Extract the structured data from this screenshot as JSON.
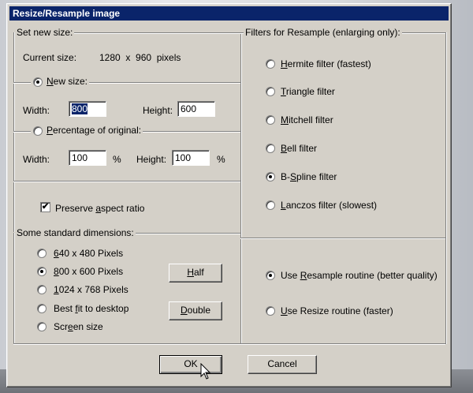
{
  "dialog": {
    "title": "Resize/Resample image"
  },
  "set_size": {
    "legend": "Set new size:",
    "current_label": "Current size:",
    "current_value": "1280  x  960  pixels",
    "new_size_label": "New size:",
    "width_label": "Width:",
    "width_value": "800",
    "height_label": "Height:",
    "height_value": "600",
    "percentage_label": "Percentage of original:",
    "pct_width_label": "Width:",
    "pct_width_value": "100",
    "pct_unit": "%",
    "pct_height_label": "Height:",
    "pct_height_value": "100",
    "pct_unit2": "%",
    "aspect_label": "Preserve aspect ratio"
  },
  "standard": {
    "legend": "Some standard dimensions:",
    "items": [
      {
        "label": "640 x 480 Pixels",
        "checked": false
      },
      {
        "label": "800 x 600 Pixels",
        "checked": true
      },
      {
        "label": "1024 x 768 Pixels",
        "checked": false
      },
      {
        "label": "Best fit to desktop",
        "checked": false
      },
      {
        "label": "Screen size",
        "checked": false
      }
    ],
    "half_label": "Half",
    "double_label": "Double"
  },
  "filters": {
    "legend": "Filters for Resample (enlarging only):",
    "items": [
      {
        "label": "Hermite filter (fastest)",
        "checked": false
      },
      {
        "label": "Triangle filter",
        "checked": false
      },
      {
        "label": "Mitchell filter",
        "checked": false
      },
      {
        "label": "Bell filter",
        "checked": false
      },
      {
        "label": "B-Spline filter",
        "checked": true
      },
      {
        "label": "Lanczos filter (slowest)",
        "checked": false
      }
    ]
  },
  "routine": {
    "resample_label": "Use Resample routine (better quality)",
    "resize_label": "Use Resize routine (faster)"
  },
  "footer": {
    "ok_label": "OK",
    "cancel_label": "Cancel"
  }
}
